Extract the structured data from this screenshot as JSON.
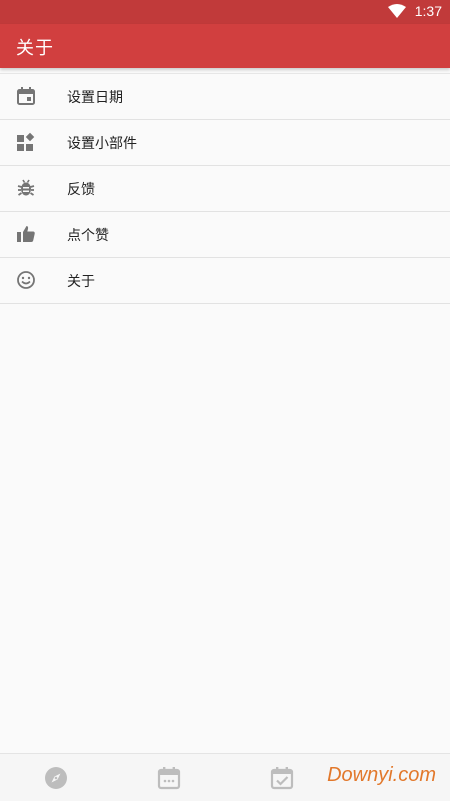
{
  "status_bar": {
    "time": "1:37",
    "wifi_icon": "wifi-icon"
  },
  "app_bar": {
    "title": "关于",
    "color": "#d13f3f"
  },
  "menu": {
    "items": [
      {
        "label": "设置日期",
        "icon": "calendar-event-icon"
      },
      {
        "label": "设置小部件",
        "icon": "widgets-icon"
      },
      {
        "label": "反馈",
        "icon": "bug-icon"
      },
      {
        "label": "点个赞",
        "icon": "thumb-up-icon"
      },
      {
        "label": "关于",
        "icon": "smiley-icon"
      }
    ]
  },
  "bottom_nav": {
    "items": [
      {
        "icon": "compass-icon"
      },
      {
        "icon": "calendar-icon"
      },
      {
        "icon": "checkbox-calendar-icon"
      }
    ]
  },
  "watermark": {
    "text": "Downyi.com",
    "color": "#e2782b"
  }
}
